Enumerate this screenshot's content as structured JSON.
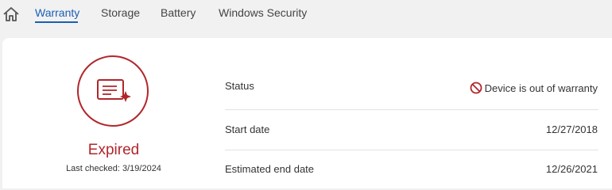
{
  "nav": {
    "home_icon": "home-icon",
    "tabs": [
      {
        "label": "Warranty",
        "active": true
      },
      {
        "label": "Storage",
        "active": false
      },
      {
        "label": "Battery",
        "active": false
      },
      {
        "label": "Windows Security",
        "active": false
      }
    ]
  },
  "warranty": {
    "status_word": "Expired",
    "last_checked": "Last checked: 3/19/2024",
    "icon": "certificate-icon",
    "accent_color": "#b1262b",
    "rows": [
      {
        "label": "Status",
        "value": "Device is out of warranty",
        "icon": "prohibited-icon"
      },
      {
        "label": "Start date",
        "value": "12/27/2018"
      },
      {
        "label": "Estimated end date",
        "value": "12/26/2021"
      }
    ]
  }
}
